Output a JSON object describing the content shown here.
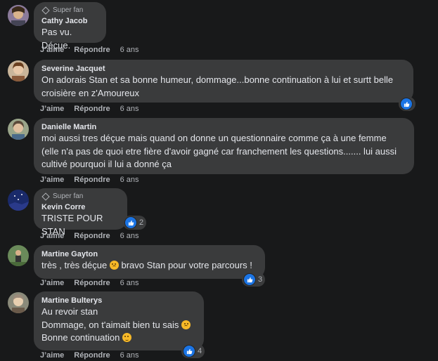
{
  "actions": {
    "like": "J’aime",
    "reply": "Répondre"
  },
  "comments": [
    {
      "badge": "Super fan",
      "author": "Cathy Jacob",
      "lines": [
        "Pas vu. Déçue."
      ],
      "time": "6 ans"
    },
    {
      "author": "Severine Jacquet",
      "lines": [
        "On adorais Stan et sa bonne humeur, dommage...bonne continuation à lui et surtt belle",
        "croisière en z'Amoureux"
      ],
      "time": "6 ans",
      "reactions": ""
    },
    {
      "author": "Danielle Martin",
      "lines": [
        "moi aussi tres déçue mais quand on donne un questionnaire comme ça à une femme",
        "(elle n'a pas de quoi etre fière d'avoir gagné car franchement les questions....... lui aussi",
        "cultivé pourquoi il lui a donné ça"
      ],
      "time": "6 ans"
    },
    {
      "badge": "Super fan",
      "author": "Kevin Corre",
      "lines": [
        "TRISTE POUR STAN"
      ],
      "time": "6 ans",
      "reactions": "2"
    },
    {
      "author": "Martine Gayton",
      "line_a": "très , très déçue",
      "line_b": "bravo Stan pour votre parcours !",
      "time": "6 ans",
      "reactions": "3"
    },
    {
      "author": "Martine Bulterys",
      "lines": [
        "Au revoir stan"
      ],
      "line_a": "Dommage, on t'aimait bien tu sais",
      "line_b": "Bonne continuation",
      "time": "6 ans",
      "reactions": "4"
    }
  ],
  "colors": {
    "background": "#18191a",
    "bubble": "#3a3b3c",
    "like_blue": "#1b74e4",
    "muted": "#b0b3b8"
  },
  "icons": {
    "like": "thumbs-up-icon",
    "badge": "diamond-icon",
    "sad": "sad-emoji",
    "smirk": "smirk-emoji"
  }
}
